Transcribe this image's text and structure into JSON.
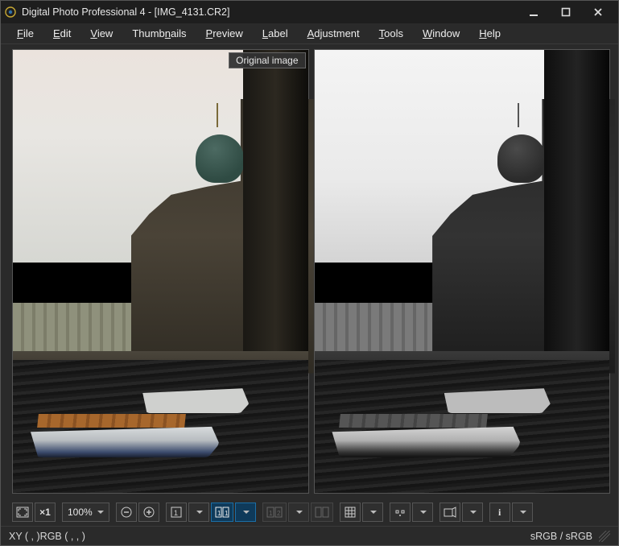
{
  "titlebar": {
    "title": "Digital Photo Professional 4 - [IMG_4131.CR2]"
  },
  "menu": {
    "items": [
      {
        "label": "File",
        "u": 0
      },
      {
        "label": "Edit",
        "u": 0
      },
      {
        "label": "View",
        "u": 0
      },
      {
        "label": "Thumbnails",
        "u": 4
      },
      {
        "label": "Preview",
        "u": 0
      },
      {
        "label": "Label",
        "u": 0
      },
      {
        "label": "Adjustment",
        "u": 0
      },
      {
        "label": "Tools",
        "u": 0
      },
      {
        "label": "Window",
        "u": 0
      },
      {
        "label": "Help",
        "u": 0
      }
    ]
  },
  "panes": {
    "left_label": "Original image"
  },
  "toolbar": {
    "fit_icon": "fit-screen-icon",
    "x1_label": "×1",
    "zoom_pct": "100%",
    "zoom_out": "zoom-out-icon",
    "zoom_in": "zoom-in-icon",
    "split_single": "single-pane-icon",
    "split_dual": "dual-pane-icon",
    "pin12": "1 2",
    "compare": "compare-icon",
    "grid": "grid-icon",
    "afpoint": "af-point-icon",
    "warn": "highlight-warn-icon",
    "info": "i"
  },
  "status": {
    "left": "XY (   ,   )RGB (   ,   ,   )",
    "right": "sRGB / sRGB"
  }
}
